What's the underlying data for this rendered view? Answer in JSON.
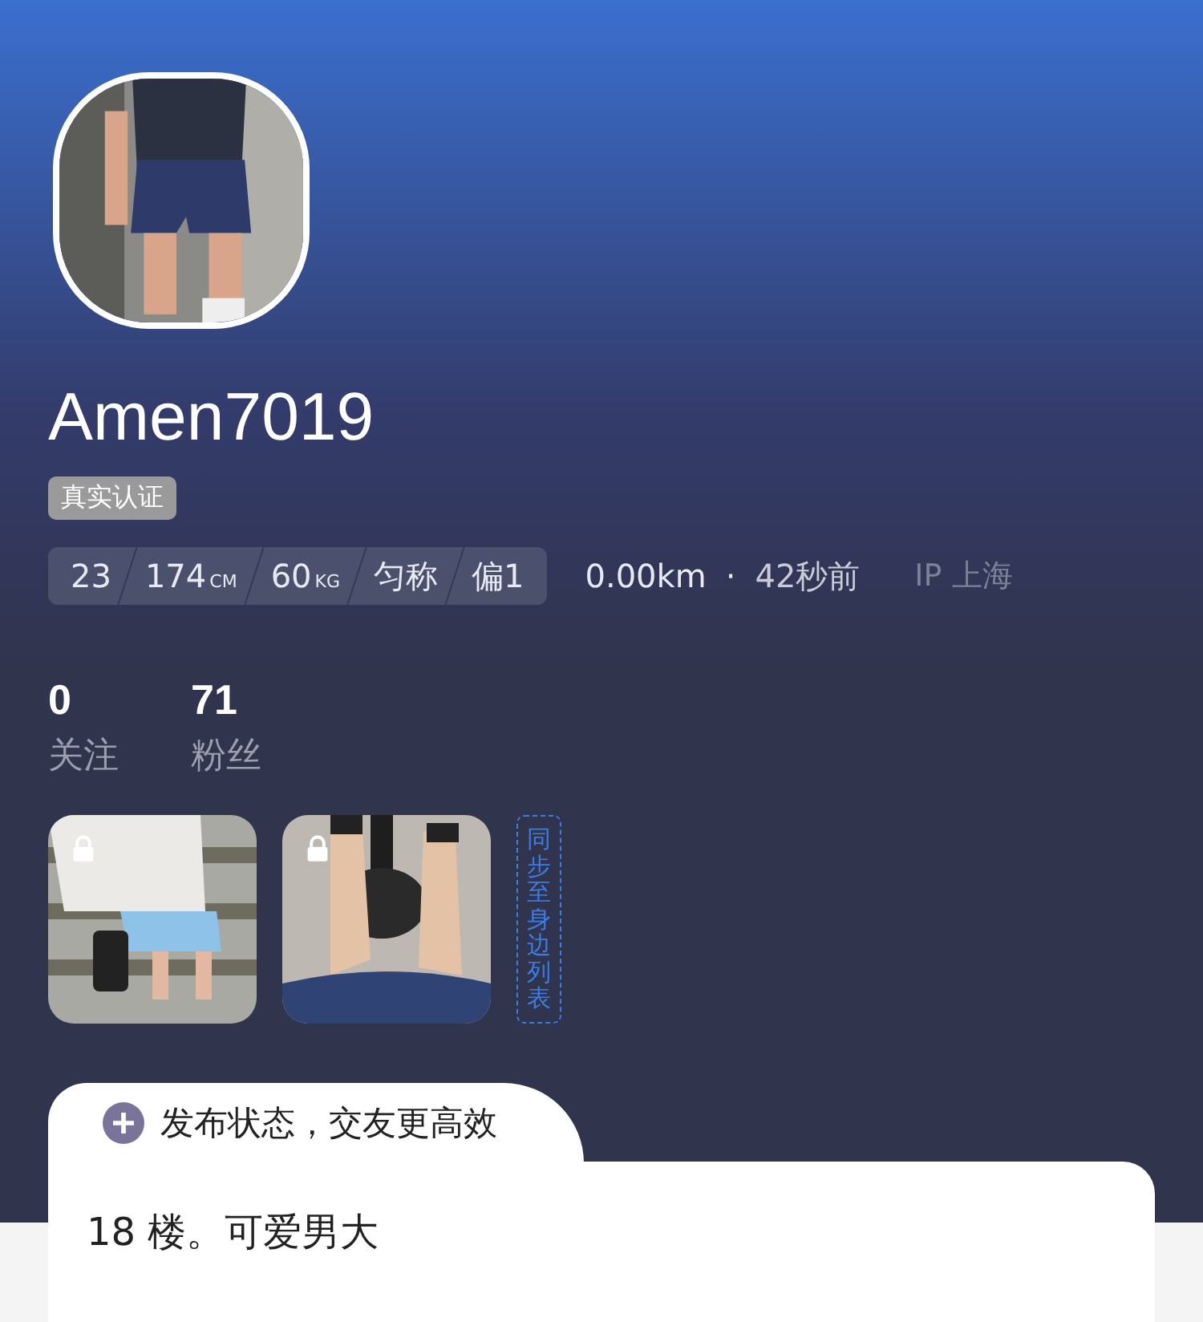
{
  "profile": {
    "username": "Amen7019",
    "verified_badge": "真实认证",
    "stats": [
      {
        "value": "23"
      },
      {
        "value": "174",
        "unit": "CM"
      },
      {
        "value": "60",
        "unit": "KG"
      },
      {
        "value": "匀称"
      },
      {
        "value": "偏1"
      }
    ],
    "distance": "0.00km",
    "separator": "·",
    "last_seen": "42秒前",
    "ip_location": "IP 上海"
  },
  "counts": [
    {
      "number": "0",
      "label": "关注"
    },
    {
      "number": "71",
      "label": "粉丝"
    }
  ],
  "photos": [
    {
      "locked": true
    },
    {
      "locked": true
    }
  ],
  "sync_button": "同步至身边列表",
  "post_tab": {
    "label": "发布状态，交友更高效"
  },
  "bio": "18 楼。可爱男大"
}
